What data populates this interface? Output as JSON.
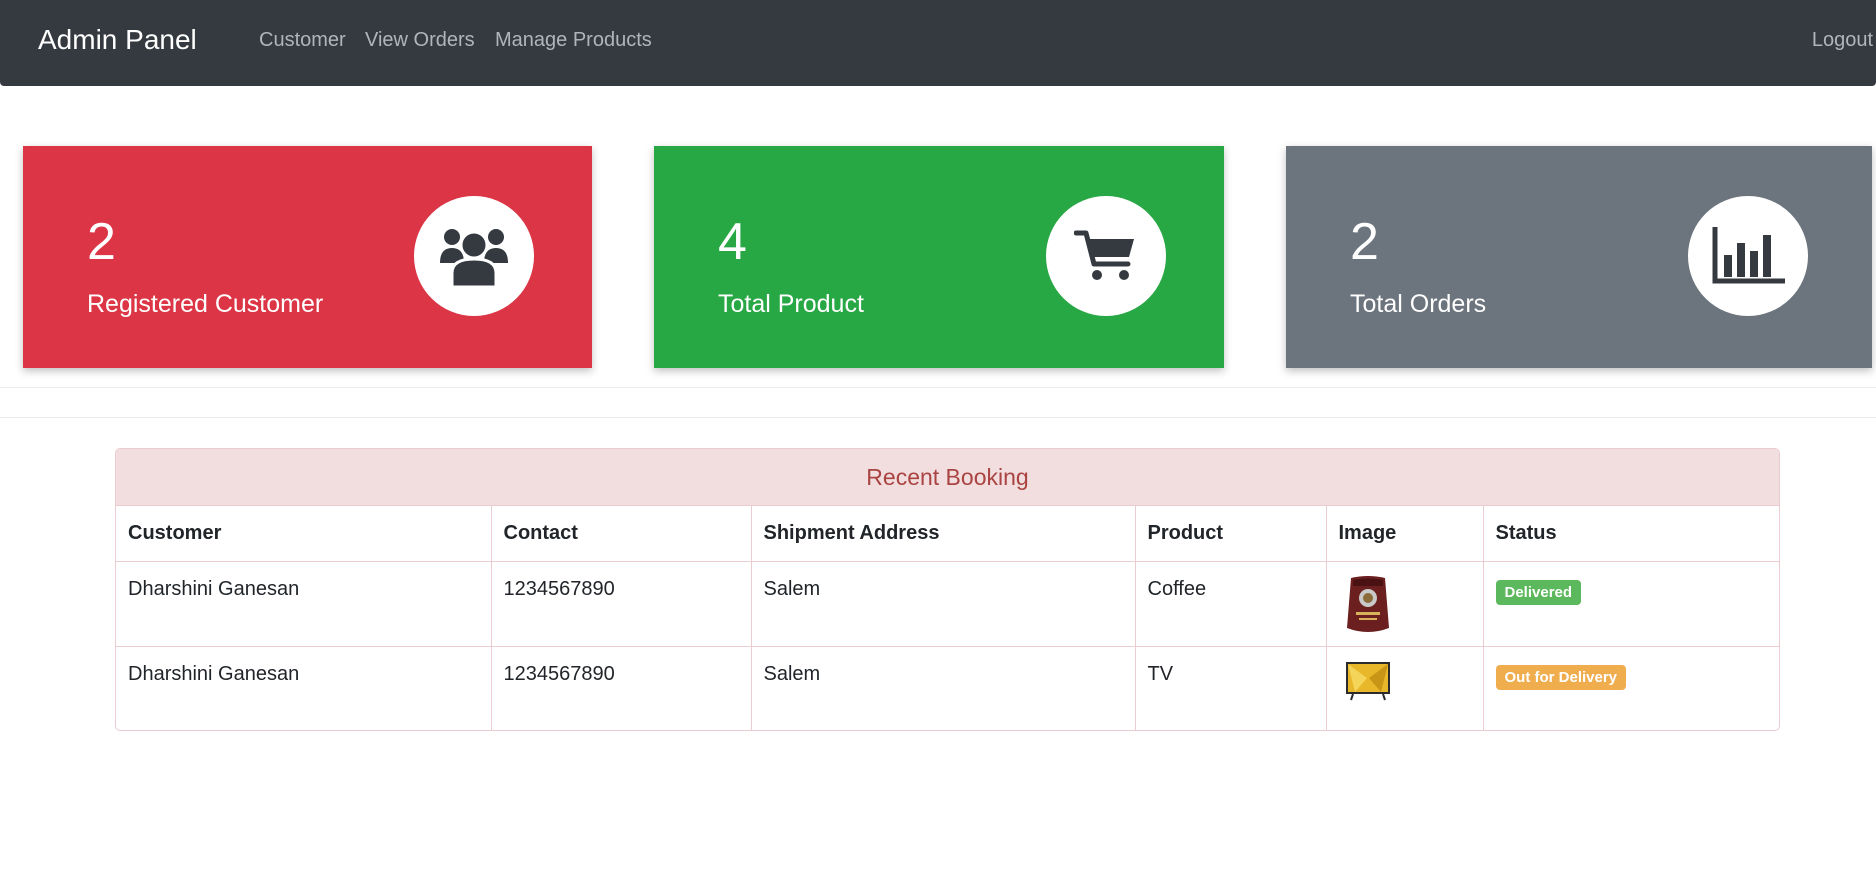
{
  "navbar": {
    "brand": "Admin Panel",
    "links": [
      "Customer",
      "View Orders",
      "Manage Products"
    ],
    "logout": "Logout"
  },
  "stats": [
    {
      "value": "2",
      "label": "Registered Customer",
      "color": "#dc3545",
      "icon": "users-icon"
    },
    {
      "value": "4",
      "label": "Total Product",
      "color": "#28a745",
      "icon": "cart-icon"
    },
    {
      "value": "2",
      "label": "Total Orders",
      "color": "#6c757d",
      "icon": "bar-chart-icon"
    }
  ],
  "booking": {
    "title": "Recent Booking",
    "columns": [
      "Customer",
      "Contact",
      "Shipment Address",
      "Product",
      "Image",
      "Status"
    ],
    "rows": [
      {
        "customer": "Dharshini Ganesan",
        "contact": "1234567890",
        "address": "Salem",
        "product": "Coffee",
        "image": "coffee-pack-image",
        "status": "Delivered",
        "status_color": "#5cb85c"
      },
      {
        "customer": "Dharshini Ganesan",
        "contact": "1234567890",
        "address": "Salem",
        "product": "TV",
        "image": "tv-image",
        "status": "Out for Delivery",
        "status_color": "#f0ad4e"
      }
    ]
  }
}
